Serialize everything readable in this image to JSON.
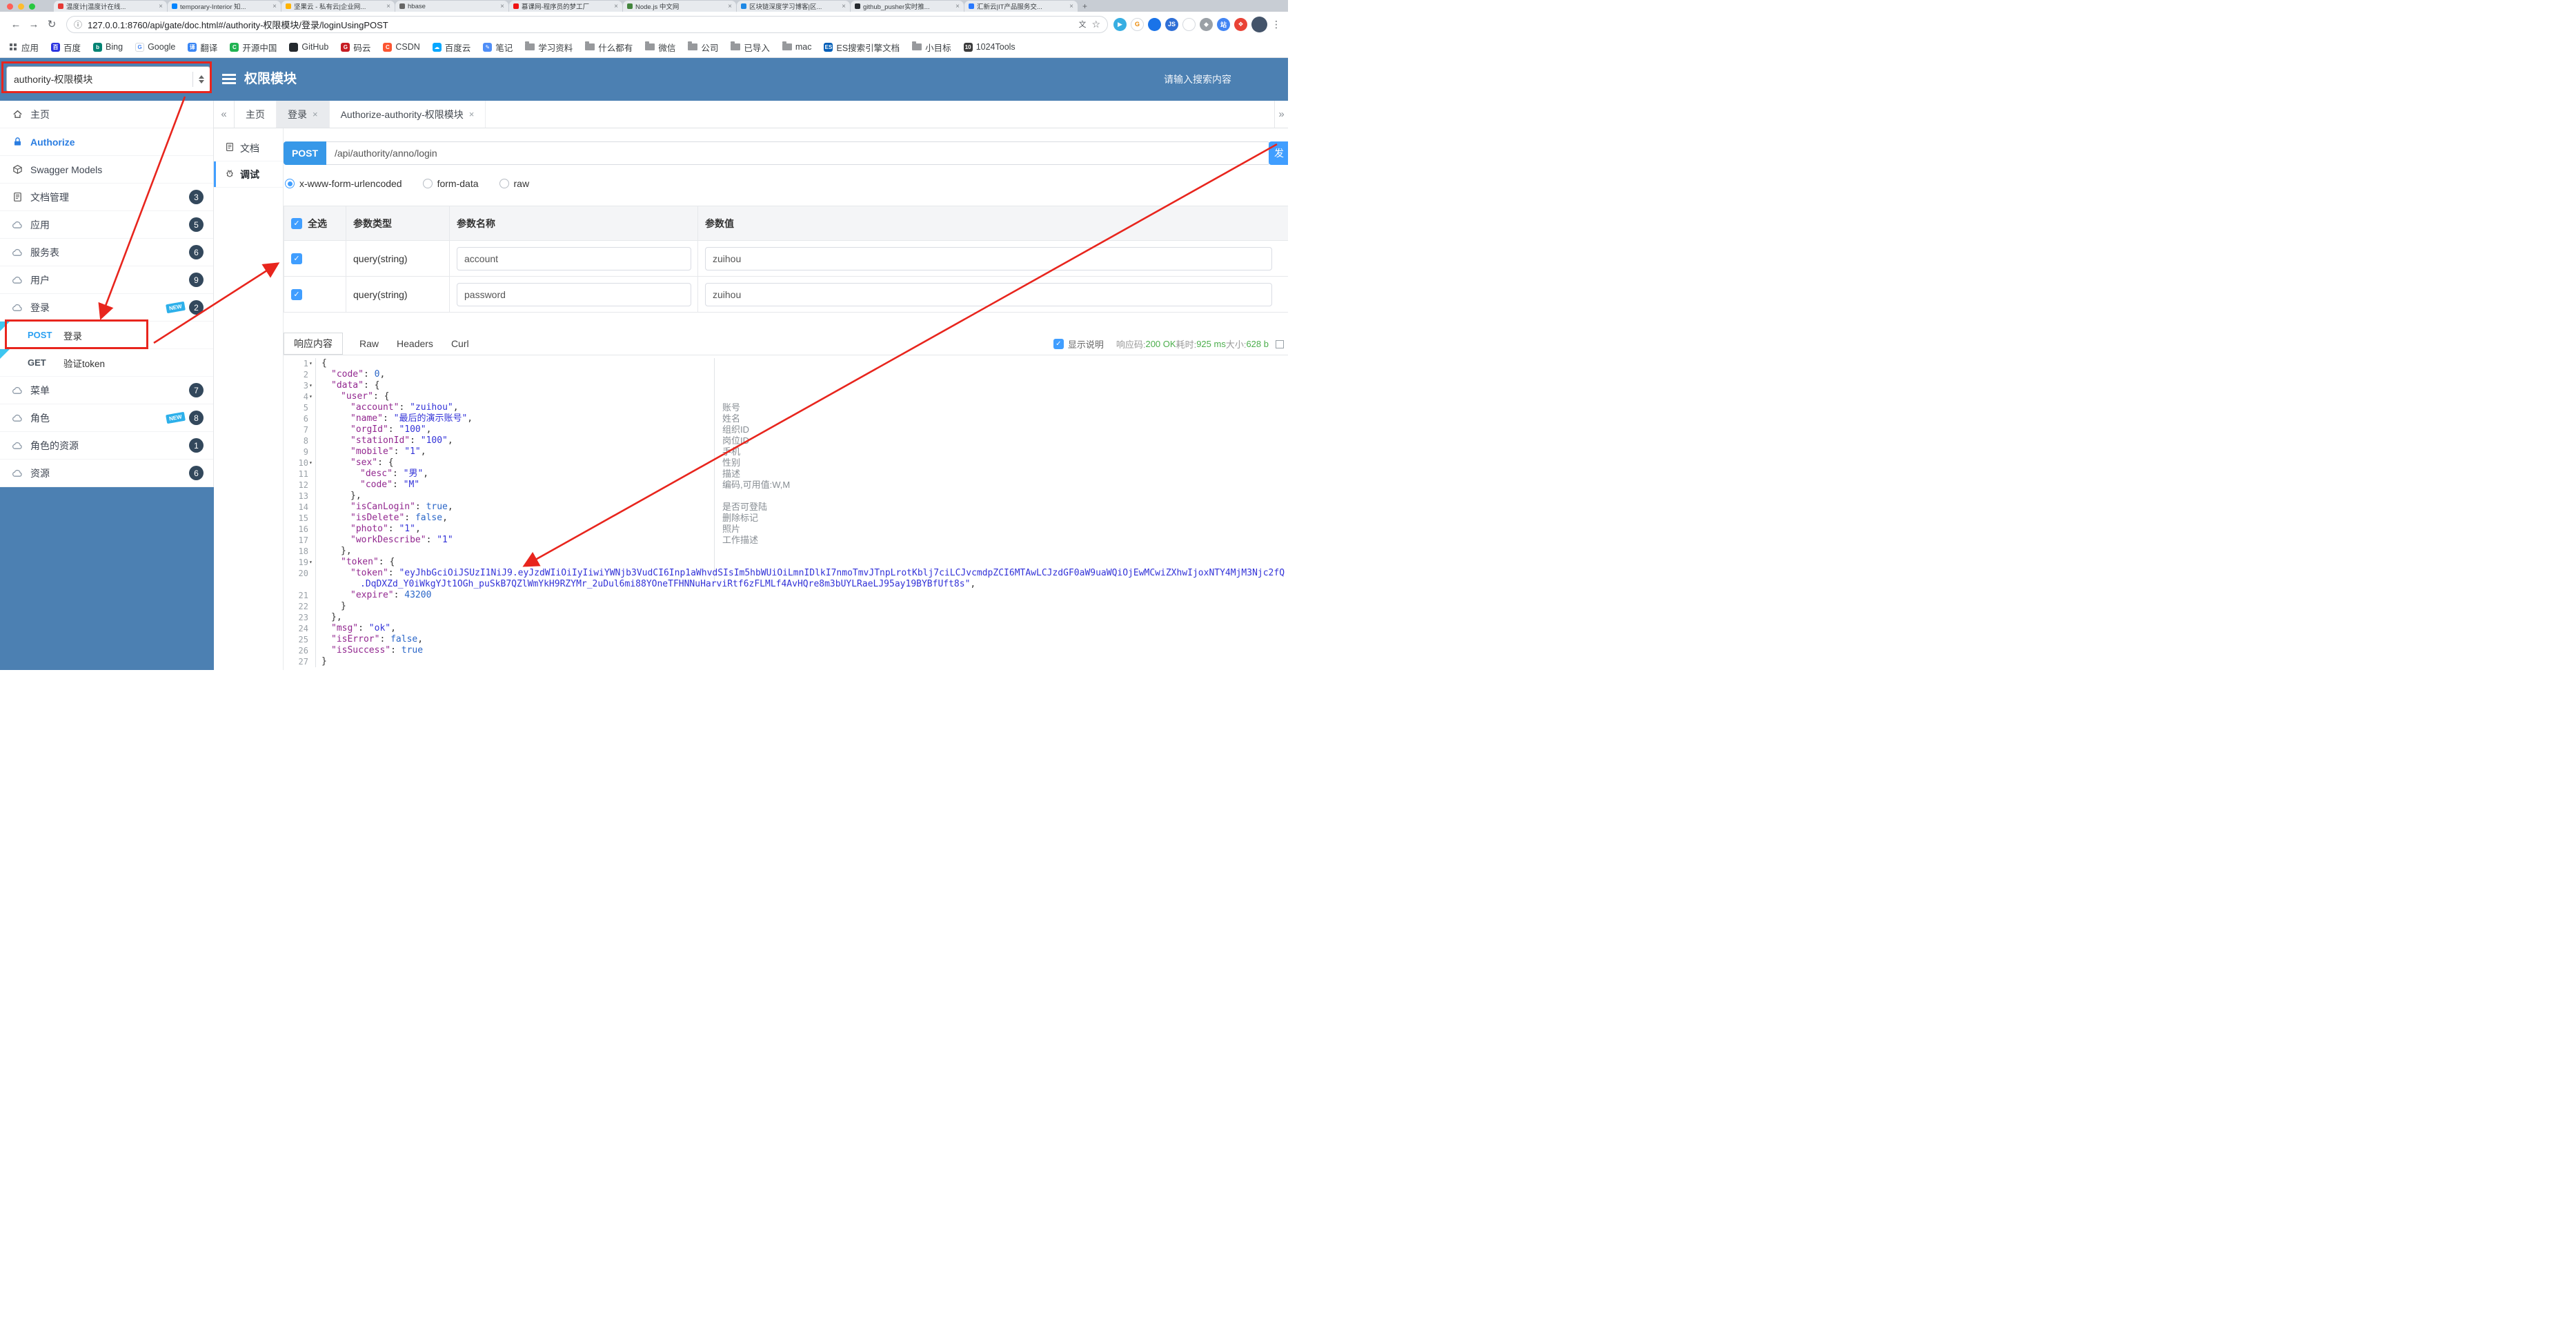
{
  "colors": {
    "accent": "#409eff",
    "header_blue": "#4c80b2",
    "annotation_red": "#e8251d",
    "method_post_blue": "#2ba0f2",
    "success_green": "#4cae4c",
    "badge_navy": "#33485c",
    "json_key": "#92278f",
    "json_string": "#3232d8"
  },
  "browser": {
    "tabs": [
      {
        "title": "温度计|温度计在线...",
        "fav": "#e53935"
      },
      {
        "title": "temporary-Interior 知...",
        "fav": "#0084ff"
      },
      {
        "title": "坚果云 - 私有云|企业网...",
        "fav": "#ffb300"
      },
      {
        "title": "hbase",
        "fav": "#666666"
      },
      {
        "title": "慕课网-程序员的梦工厂",
        "fav": "#f01414"
      },
      {
        "title": "Node.js 中文网",
        "fav": "#43853d"
      },
      {
        "title": "区块链深度学习博客|区...",
        "fav": "#1e88e5"
      },
      {
        "title": "github_pusher实时推...",
        "fav": "#24292e"
      },
      {
        "title": "汇新云|IT产品服务交...",
        "fav": "#2979ff"
      }
    ],
    "new_tab_icon": "+",
    "url": "127.0.0.1:8760/api/gate/doc.html#/authority-权限模块/登录/loginUsingPOST",
    "extensions": [
      {
        "glyph": "▶",
        "bg": "#37aee2",
        "fg": "#ffffff"
      },
      {
        "glyph": "G",
        "bg": "#ffffff",
        "fg": "#ea8600",
        "border": true
      },
      {
        "glyph": "",
        "bg": "#1a73e8",
        "fg": "#ffffff"
      },
      {
        "glyph": "JS",
        "bg": "#2f6fd6",
        "fg": "#ffffff"
      },
      {
        "glyph": "",
        "bg": "#ffffff",
        "fg": "#5f6368",
        "border": true
      },
      {
        "glyph": "◆",
        "bg": "#9aa0a6",
        "fg": "#ffffff"
      },
      {
        "glyph": "站",
        "bg": "#4285f4",
        "fg": "#ffffff"
      },
      {
        "glyph": "❖",
        "bg": "#e94235",
        "fg": "#ffffff"
      }
    ],
    "bookmarks": [
      {
        "label": "应用",
        "type": "apps"
      },
      {
        "label": "百度",
        "type": "site",
        "bg": "#2932e1",
        "glyph": "百"
      },
      {
        "label": "Bing",
        "type": "site",
        "bg": "#008373",
        "glyph": "b"
      },
      {
        "label": "Google",
        "type": "site",
        "bg": "#ffffff",
        "fg": "#4285f4",
        "glyph": "G",
        "border": true
      },
      {
        "label": "翻译",
        "type": "site",
        "bg": "#3a86f4",
        "glyph": "译"
      },
      {
        "label": "开源中国",
        "type": "site",
        "bg": "#21b352",
        "glyph": "C"
      },
      {
        "label": "GitHub",
        "type": "site",
        "bg": "#24292e",
        "glyph": ""
      },
      {
        "label": "码云",
        "type": "site",
        "bg": "#c71d23",
        "glyph": "G"
      },
      {
        "label": "CSDN",
        "type": "site",
        "bg": "#fc5531",
        "glyph": "C"
      },
      {
        "label": "百度云",
        "type": "site",
        "bg": "#06a7ff",
        "glyph": "☁"
      },
      {
        "label": "笔记",
        "type": "site",
        "bg": "#4f8ef7",
        "glyph": "✎"
      },
      {
        "label": "学习资料",
        "type": "folder"
      },
      {
        "label": "什么都有",
        "type": "folder"
      },
      {
        "label": "微信",
        "type": "folder"
      },
      {
        "label": "公司",
        "type": "folder"
      },
      {
        "label": "已导入",
        "type": "folder"
      },
      {
        "label": "mac",
        "type": "folder"
      },
      {
        "label": "ES搜索引擎文档",
        "type": "site",
        "bg": "#005eb8",
        "glyph": "ES"
      },
      {
        "label": "小目标",
        "type": "folder"
      },
      {
        "label": "1024Tools",
        "type": "site",
        "bg": "#3b3b3b",
        "glyph": "10"
      }
    ]
  },
  "header": {
    "module_select": "authority-权限模块",
    "title": "权限模块",
    "search_placeholder": "请输入搜索内容"
  },
  "sidebar": {
    "items": [
      {
        "kind": "item",
        "icon": "home",
        "label": "主页"
      },
      {
        "kind": "item",
        "icon": "lock",
        "label": "Authorize",
        "accent": true
      },
      {
        "kind": "item",
        "icon": "cube",
        "label": "Swagger Models"
      },
      {
        "kind": "item",
        "icon": "doc",
        "label": "文档管理",
        "badge": "3"
      },
      {
        "kind": "item",
        "icon": "cloud",
        "label": "应用",
        "badge": "5"
      },
      {
        "kind": "item",
        "icon": "cloud",
        "label": "服务表",
        "badge": "6"
      },
      {
        "kind": "item",
        "icon": "cloud",
        "label": "用户",
        "badge": "9"
      },
      {
        "kind": "item",
        "icon": "cloud",
        "label": "登录",
        "badge": "2",
        "new": true
      },
      {
        "kind": "sub",
        "method": "POST",
        "label": "登录"
      },
      {
        "kind": "sub",
        "method": "GET",
        "label": "验证token"
      },
      {
        "kind": "item",
        "icon": "cloud",
        "label": "菜单",
        "badge": "7"
      },
      {
        "kind": "item",
        "icon": "cloud",
        "label": "角色",
        "badge": "8",
        "new": true
      },
      {
        "kind": "item",
        "icon": "cloud",
        "label": "角色的资源",
        "badge": "1"
      },
      {
        "kind": "item",
        "icon": "cloud",
        "label": "资源",
        "badge": "6"
      }
    ]
  },
  "main": {
    "collapse_left": "«",
    "collapse_right": "»",
    "tabs": [
      {
        "label": "主页",
        "closable": false,
        "active": false
      },
      {
        "label": "登录",
        "closable": true,
        "active": true
      },
      {
        "label": "Authorize-authority-权限模块",
        "closable": true,
        "active": false
      }
    ]
  },
  "doc_tabs": {
    "doc_label": "文档",
    "debug_label": "调试"
  },
  "request": {
    "method": "POST",
    "url": "/api/authority/anno/login",
    "send_label": "发",
    "content_types": [
      "x-www-form-urlencoded",
      "form-data",
      "raw"
    ],
    "selected_content_type": "x-www-form-urlencoded"
  },
  "params_table": {
    "headers": [
      "全选",
      "参数类型",
      "参数名称",
      "参数值"
    ],
    "rows": [
      {
        "checked": true,
        "type": "query(string)",
        "name": "account",
        "value": "zuihou"
      },
      {
        "checked": true,
        "type": "query(string)",
        "name": "password",
        "value": "zuihou"
      }
    ]
  },
  "response": {
    "tabs": [
      "响应内容",
      "Raw",
      "Headers",
      "Curl"
    ],
    "active_tab": "响应内容",
    "show_desc": "显示说明",
    "status_label": "响应码:",
    "status": "200 OK",
    "time_label": "耗时:",
    "time": "925 ms",
    "size_label": "大小:",
    "size": "628 b"
  },
  "json_viewer": {
    "lines": [
      {
        "n": "1",
        "c": true,
        "i": 0,
        "t": [
          [
            "p",
            "{"
          ]
        ]
      },
      {
        "n": "2",
        "i": 1,
        "t": [
          [
            "k",
            "code"
          ],
          [
            "p",
            ": "
          ],
          [
            "n",
            "0"
          ],
          [
            "p",
            ","
          ]
        ]
      },
      {
        "n": "3",
        "c": true,
        "i": 1,
        "t": [
          [
            "k",
            "data"
          ],
          [
            "p",
            ": {"
          ]
        ]
      },
      {
        "n": "4",
        "c": true,
        "i": 2,
        "t": [
          [
            "k",
            "user"
          ],
          [
            "p",
            ": {"
          ]
        ]
      },
      {
        "n": "5",
        "i": 3,
        "t": [
          [
            "k",
            "account"
          ],
          [
            "p",
            ": "
          ],
          [
            "s",
            "zuihou"
          ],
          [
            "p",
            ","
          ]
        ],
        "a": "账号"
      },
      {
        "n": "6",
        "i": 3,
        "t": [
          [
            "k",
            "name"
          ],
          [
            "p",
            ": "
          ],
          [
            "s",
            "最后的演示账号"
          ],
          [
            "p",
            ","
          ]
        ],
        "a": "姓名"
      },
      {
        "n": "7",
        "i": 3,
        "t": [
          [
            "k",
            "orgId"
          ],
          [
            "p",
            ": "
          ],
          [
            "s",
            "100"
          ],
          [
            "p",
            ","
          ]
        ],
        "a": "组织ID"
      },
      {
        "n": "8",
        "i": 3,
        "t": [
          [
            "k",
            "stationId"
          ],
          [
            "p",
            ": "
          ],
          [
            "s",
            "100"
          ],
          [
            "p",
            ","
          ]
        ],
        "a": "岗位ID"
      },
      {
        "n": "9",
        "i": 3,
        "t": [
          [
            "k",
            "mobile"
          ],
          [
            "p",
            ": "
          ],
          [
            "s",
            "1"
          ],
          [
            "p",
            ","
          ]
        ],
        "a": "手机"
      },
      {
        "n": "10",
        "c": true,
        "i": 3,
        "t": [
          [
            "k",
            "sex"
          ],
          [
            "p",
            ": {"
          ]
        ],
        "a": "性别"
      },
      {
        "n": "11",
        "i": 4,
        "t": [
          [
            "k",
            "desc"
          ],
          [
            "p",
            ": "
          ],
          [
            "s",
            "男"
          ],
          [
            "p",
            ","
          ]
        ],
        "a": "描述"
      },
      {
        "n": "12",
        "i": 4,
        "t": [
          [
            "k",
            "code"
          ],
          [
            "p",
            ": "
          ],
          [
            "s",
            "M"
          ]
        ],
        "a": "编码,可用值:W,M"
      },
      {
        "n": "13",
        "i": 3,
        "t": [
          [
            "p",
            "},"
          ]
        ]
      },
      {
        "n": "14",
        "i": 3,
        "t": [
          [
            "k",
            "isCanLogin"
          ],
          [
            "p",
            ": "
          ],
          [
            "b",
            "true"
          ],
          [
            "p",
            ","
          ]
        ],
        "a": "是否可登陆"
      },
      {
        "n": "15",
        "i": 3,
        "t": [
          [
            "k",
            "isDelete"
          ],
          [
            "p",
            ": "
          ],
          [
            "b",
            "false"
          ],
          [
            "p",
            ","
          ]
        ],
        "a": "删除标记"
      },
      {
        "n": "16",
        "i": 3,
        "t": [
          [
            "k",
            "photo"
          ],
          [
            "p",
            ": "
          ],
          [
            "s",
            "1"
          ],
          [
            "p",
            ","
          ]
        ],
        "a": "照片"
      },
      {
        "n": "17",
        "i": 3,
        "t": [
          [
            "k",
            "workDescribe"
          ],
          [
            "p",
            ": "
          ],
          [
            "s",
            "1"
          ]
        ],
        "a": "工作描述"
      },
      {
        "n": "18",
        "i": 2,
        "t": [
          [
            "p",
            "},"
          ]
        ]
      },
      {
        "n": "19",
        "c": true,
        "i": 2,
        "t": [
          [
            "k",
            "token"
          ],
          [
            "p",
            ": {"
          ]
        ]
      },
      {
        "n": "20",
        "i": 3,
        "t": [
          [
            "k",
            "token"
          ],
          [
            "p",
            ": "
          ],
          [
            "sr",
            "\"eyJhbGciOiJSUzI1NiJ9.eyJzdWIiOiIyIiwiYWNjb3VudCI6Inp1aWhvdSIsIm5hbWUiOiLmnIDlkI7nmoTmvJTnpLrotKblj7ciLCJvcmdpZCI6MTAwLCJzdGF0aW9uaWQiOjEwMCwiZXhwIjoxNTY4MjM3Njc2fQ"
          ]
        ]
      },
      {
        "n": "",
        "i": 4,
        "t": [
          [
            "sr",
            ".DqDXZd_Y0iWkgYJt1OGh_puSkB7QZlWmYkH9RZYMr_2uDul6mi88YOneTFHNNuHarviRtf6zFLMLf4AvHQre8m3bUYLRaeLJ95ay19BYBfUft8s\""
          ],
          [
            "p",
            ","
          ]
        ]
      },
      {
        "n": "21",
        "i": 3,
        "t": [
          [
            "k",
            "expire"
          ],
          [
            "p",
            ": "
          ],
          [
            "n",
            "43200"
          ]
        ]
      },
      {
        "n": "22",
        "i": 2,
        "t": [
          [
            "p",
            "}"
          ]
        ]
      },
      {
        "n": "23",
        "i": 1,
        "t": [
          [
            "p",
            "},"
          ]
        ]
      },
      {
        "n": "24",
        "i": 1,
        "t": [
          [
            "k",
            "msg"
          ],
          [
            "p",
            ": "
          ],
          [
            "s",
            "ok"
          ],
          [
            "p",
            ","
          ]
        ]
      },
      {
        "n": "25",
        "i": 1,
        "t": [
          [
            "k",
            "isError"
          ],
          [
            "p",
            ": "
          ],
          [
            "b",
            "false"
          ],
          [
            "p",
            ","
          ]
        ]
      },
      {
        "n": "26",
        "i": 1,
        "t": [
          [
            "k",
            "isSuccess"
          ],
          [
            "p",
            ": "
          ],
          [
            "b",
            "true"
          ]
        ]
      },
      {
        "n": "27",
        "i": 0,
        "t": [
          [
            "p",
            "}"
          ]
        ]
      }
    ]
  }
}
